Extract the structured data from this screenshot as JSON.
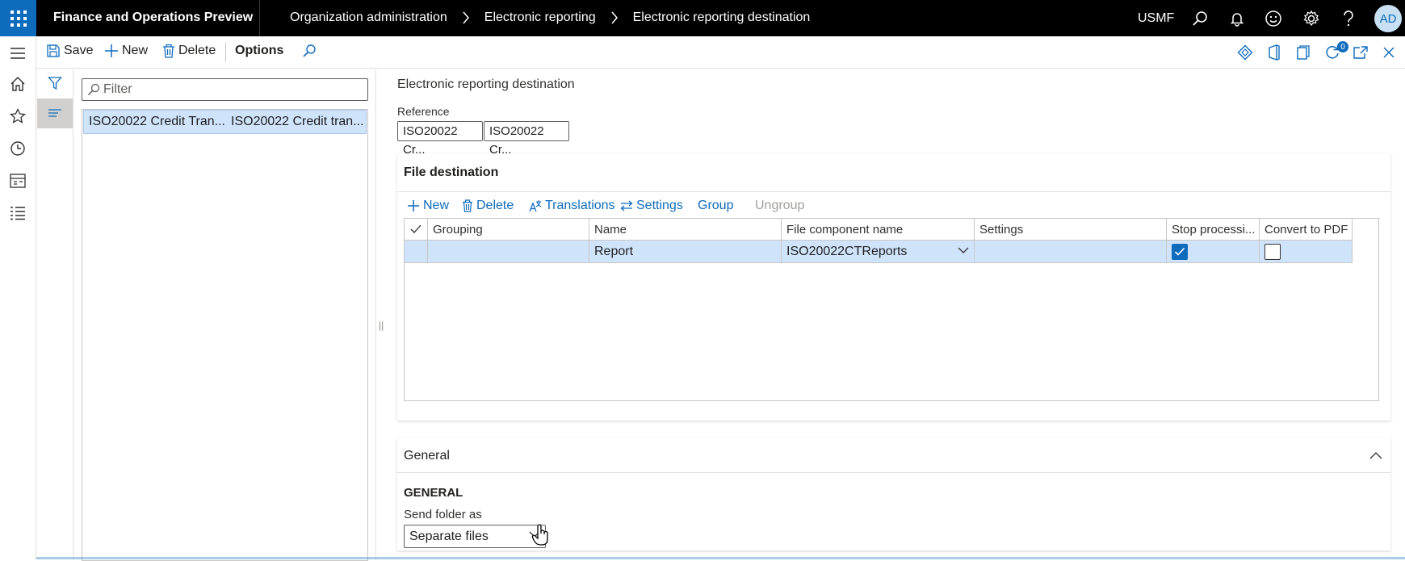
{
  "topbar": {
    "app_title": "Finance and Operations Preview",
    "breadcrumbs": [
      "Organization administration",
      "Electronic reporting",
      "Electronic reporting destination"
    ],
    "company": "USMF",
    "avatar_initials": "AD",
    "accent_color": "#0f6cbd"
  },
  "actions": {
    "save": "Save",
    "new": "New",
    "delete": "Delete",
    "options": "Options",
    "notification_count": "0"
  },
  "list": {
    "filter_placeholder": "Filter",
    "rows": [
      {
        "col1": "ISO20022 Credit Tran...",
        "col2": "ISO20022 Credit tran..."
      }
    ]
  },
  "main": {
    "page_title": "Electronic reporting destination",
    "reference_label": "Reference",
    "reference_buttons": [
      "ISO20022 Cr...",
      "ISO20022 Cr..."
    ],
    "file_destination": {
      "title": "File destination",
      "toolbar": {
        "new": "New",
        "delete": "Delete",
        "translations": "Translations",
        "settings": "Settings",
        "group": "Group",
        "ungroup": "Ungroup"
      },
      "columns": [
        "Grouping",
        "Name",
        "File component name",
        "Settings",
        "Stop processi...",
        "Convert to PDF"
      ],
      "rows": [
        {
          "grouping": "",
          "name": "Report",
          "file_component": "ISO20022CTReports",
          "settings": "",
          "stop_processing": true,
          "convert_pdf": false
        }
      ]
    },
    "general": {
      "title": "General",
      "section_heading": "GENERAL",
      "send_folder_label": "Send folder as",
      "send_folder_value": "Separate files"
    }
  }
}
